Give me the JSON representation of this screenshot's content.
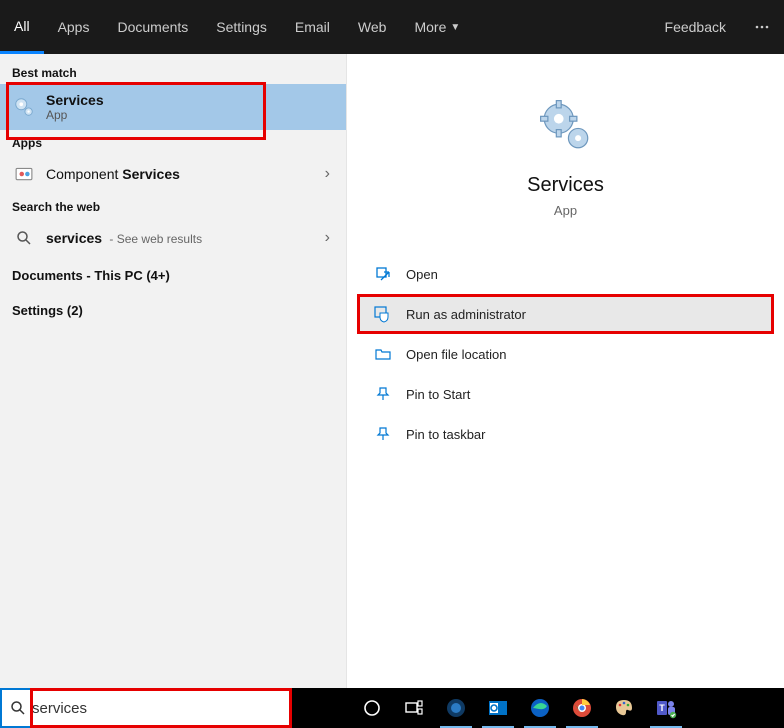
{
  "header": {
    "tabs": [
      "All",
      "Apps",
      "Documents",
      "Settings",
      "Email",
      "Web"
    ],
    "more_label": "More",
    "feedback_label": "Feedback"
  },
  "left": {
    "best_match_header": "Best match",
    "best_match": {
      "name": "Services",
      "type": "App"
    },
    "apps_header": "Apps",
    "apps_item_prefix": "Component ",
    "apps_item_bold": "Services",
    "web_header": "Search the web",
    "web_item_bold": "services",
    "web_item_hint": " - See web results",
    "docs_row": "Documents - This PC (4+)",
    "settings_row": "Settings (2)"
  },
  "preview": {
    "title": "Services",
    "subtitle": "App",
    "actions": [
      {
        "label": "Open",
        "icon": "open"
      },
      {
        "label": "Run as administrator",
        "icon": "admin",
        "highlighted": true
      },
      {
        "label": "Open file location",
        "icon": "folder"
      },
      {
        "label": "Pin to Start",
        "icon": "pin"
      },
      {
        "label": "Pin to taskbar",
        "icon": "pin"
      }
    ]
  },
  "search": {
    "value": "services"
  }
}
